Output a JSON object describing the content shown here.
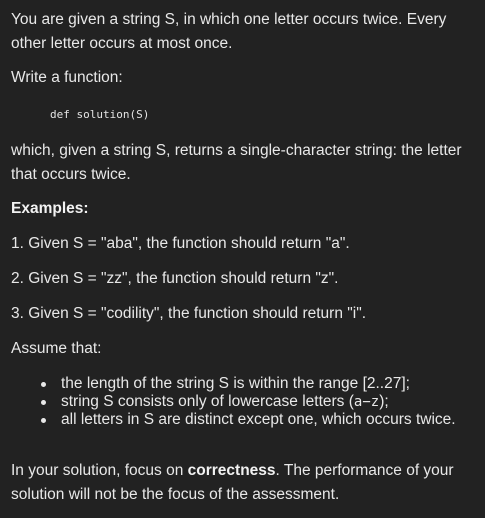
{
  "task": {
    "intro": "You are given a string S, in which one letter occurs twice. Every other letter occurs at most once.",
    "write_label": "Write a function:",
    "signature": "def solution(S)",
    "description": "which, given a string S, returns a single-character string: the letter that occurs twice.",
    "examples_heading": "Examples:",
    "examples": [
      "1. Given S = \"aba\", the function should return \"a\".",
      "2. Given S = \"zz\", the function should return \"z\".",
      "3. Given S = \"codility\", the function should return \"i\"."
    ],
    "assume_label": "Assume that:",
    "assumptions": {
      "item1": "the length of the string S is within the range [2..27];",
      "item2_prefix": "string S consists only of lowercase letters (",
      "item2_code": "a−z",
      "item2_suffix": ");",
      "item3": "all letters in S are distinct except one, which occurs twice."
    },
    "focus_prefix": "In your solution, focus on ",
    "focus_bold": "correctness",
    "focus_suffix": ". The performance of your solution will not be the focus of the assessment."
  }
}
